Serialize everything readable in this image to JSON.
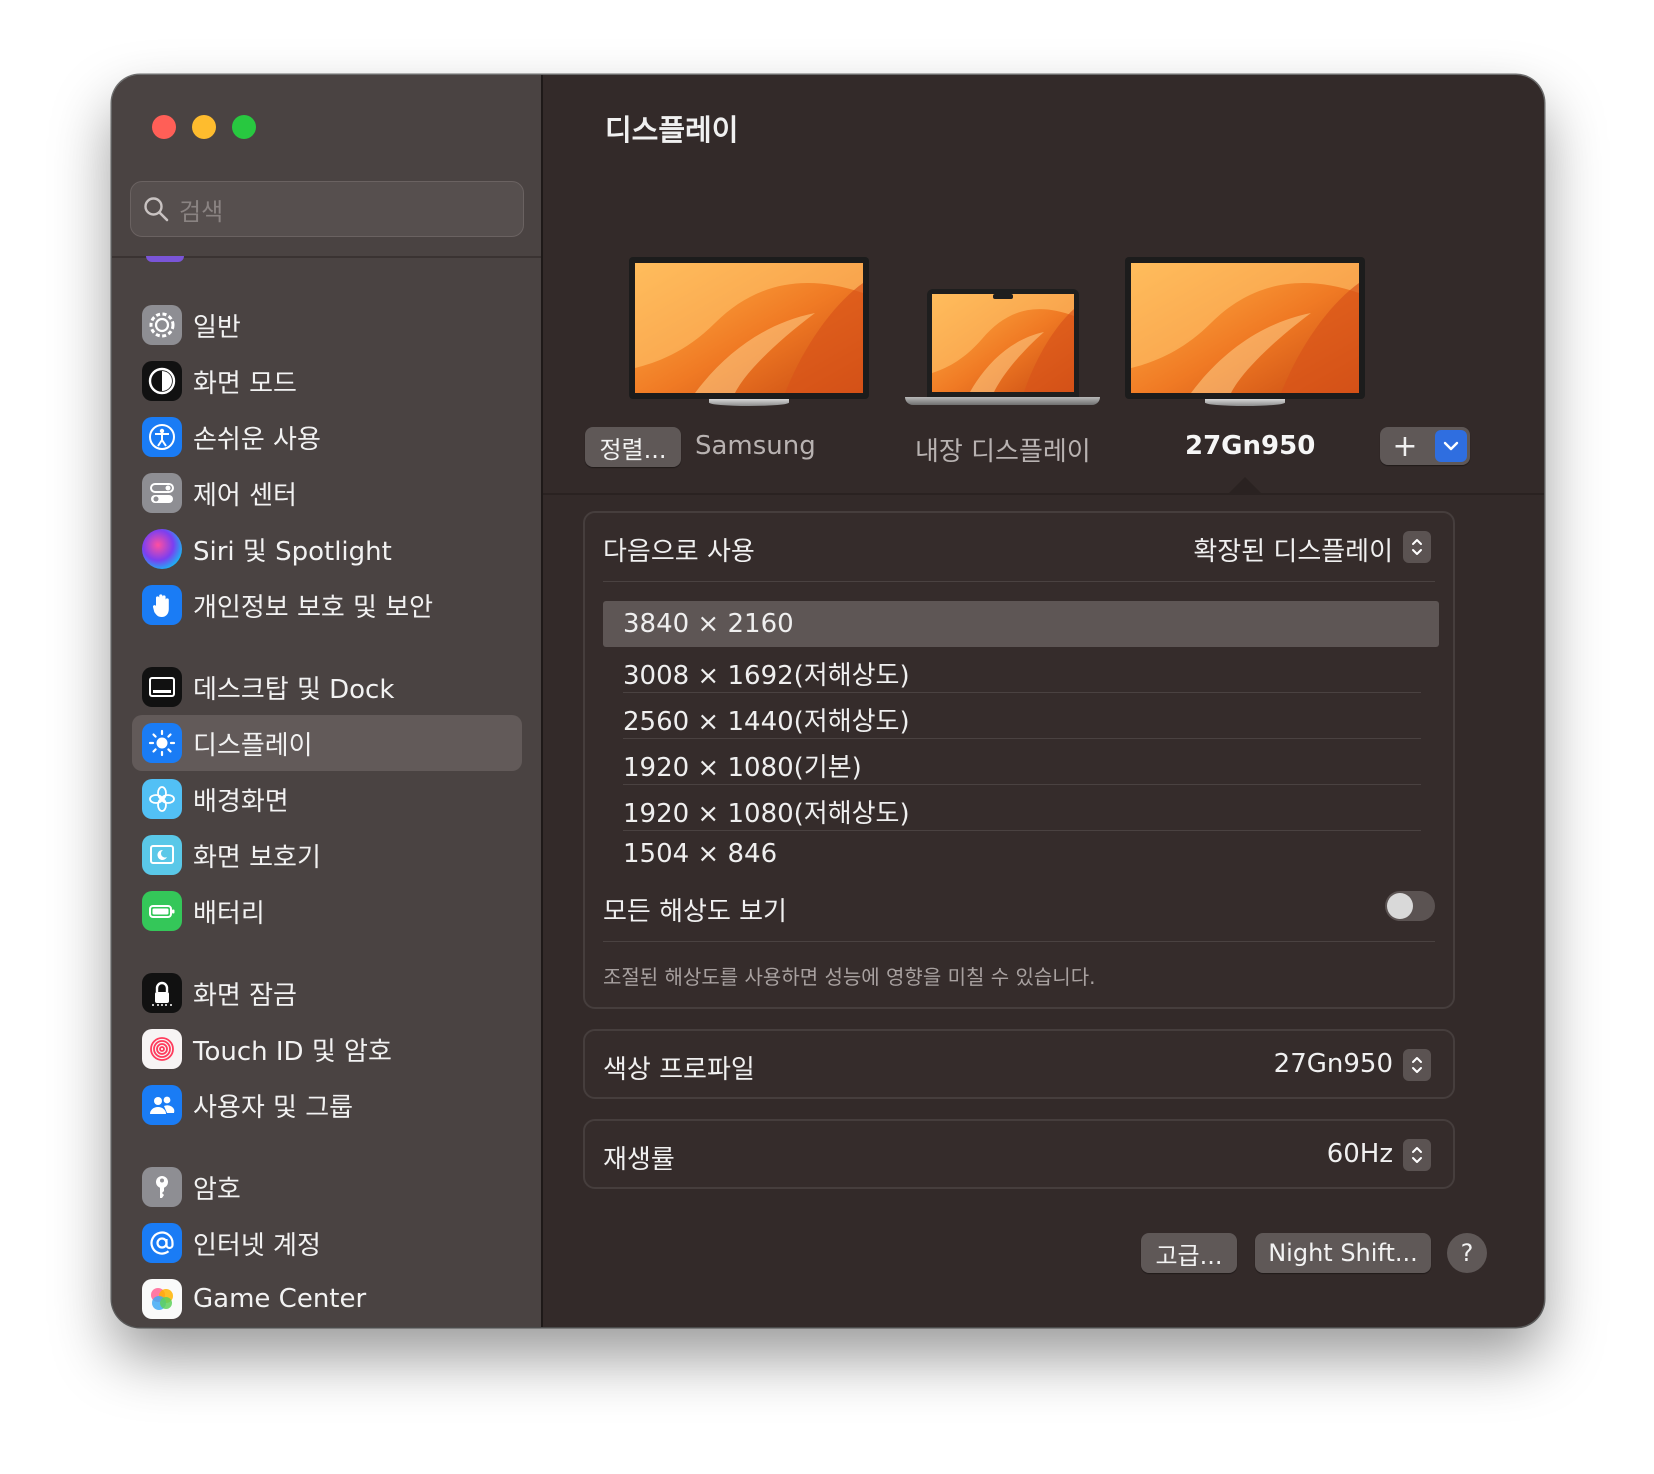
{
  "sidebar": {
    "search_placeholder": "검색",
    "items": [
      {
        "label": "일반",
        "icon": "gear-icon"
      },
      {
        "label": "화면 모드",
        "icon": "appearance-icon"
      },
      {
        "label": "손쉬운 사용",
        "icon": "accessibility-icon"
      },
      {
        "label": "제어 센터",
        "icon": "control-center-icon"
      },
      {
        "label": "Siri 및 Spotlight",
        "icon": "siri-icon"
      },
      {
        "label": "개인정보 보호 및 보안",
        "icon": "hand-icon"
      },
      {
        "label": "데스크탑 및 Dock",
        "icon": "dock-icon"
      },
      {
        "label": "디스플레이",
        "icon": "display-icon"
      },
      {
        "label": "배경화면",
        "icon": "wallpaper-icon"
      },
      {
        "label": "화면 보호기",
        "icon": "screensaver-icon"
      },
      {
        "label": "배터리",
        "icon": "battery-icon"
      },
      {
        "label": "화면 잠금",
        "icon": "lock-icon"
      },
      {
        "label": "Touch ID 및 암호",
        "icon": "fingerprint-icon"
      },
      {
        "label": "사용자 및 그룹",
        "icon": "users-icon"
      },
      {
        "label": "암호",
        "icon": "key-icon"
      },
      {
        "label": "인터넷 계정",
        "icon": "at-icon"
      },
      {
        "label": "Game Center",
        "icon": "game-center-icon"
      }
    ]
  },
  "main": {
    "title": "디스플레이",
    "arrange_button": "정렬...",
    "displays": [
      {
        "name": "Samsung"
      },
      {
        "name": "내장 디스플레이"
      },
      {
        "name": "27Gn950"
      }
    ],
    "add_button": "+",
    "use_as": {
      "label": "다음으로 사용",
      "value": "확장된 디스플레이"
    },
    "resolutions": [
      "3840 × 2160",
      "3008 × 1692(저해상도)",
      "2560 × 1440(저해상도)",
      "1920 × 1080(기본)",
      "1920 × 1080(저해상도)",
      "1504 × 846"
    ],
    "selected_resolution": "3840 × 2160",
    "show_all": {
      "label": "모든 해상도 보기",
      "on": false
    },
    "hint": "조절된 해상도를 사용하면 성능에 영향을 미칠 수 있습니다.",
    "color_profile": {
      "label": "색상 프로파일",
      "value": "27Gn950"
    },
    "refresh_rate": {
      "label": "재생률",
      "value": "60Hz"
    },
    "advanced_button": "고급...",
    "night_shift_button": "Night Shift...",
    "help_button": "?"
  },
  "colors": {
    "accent": "#2f6ee0",
    "close": "#ff5f57",
    "minimize": "#febc2e",
    "maximize": "#28c840"
  }
}
